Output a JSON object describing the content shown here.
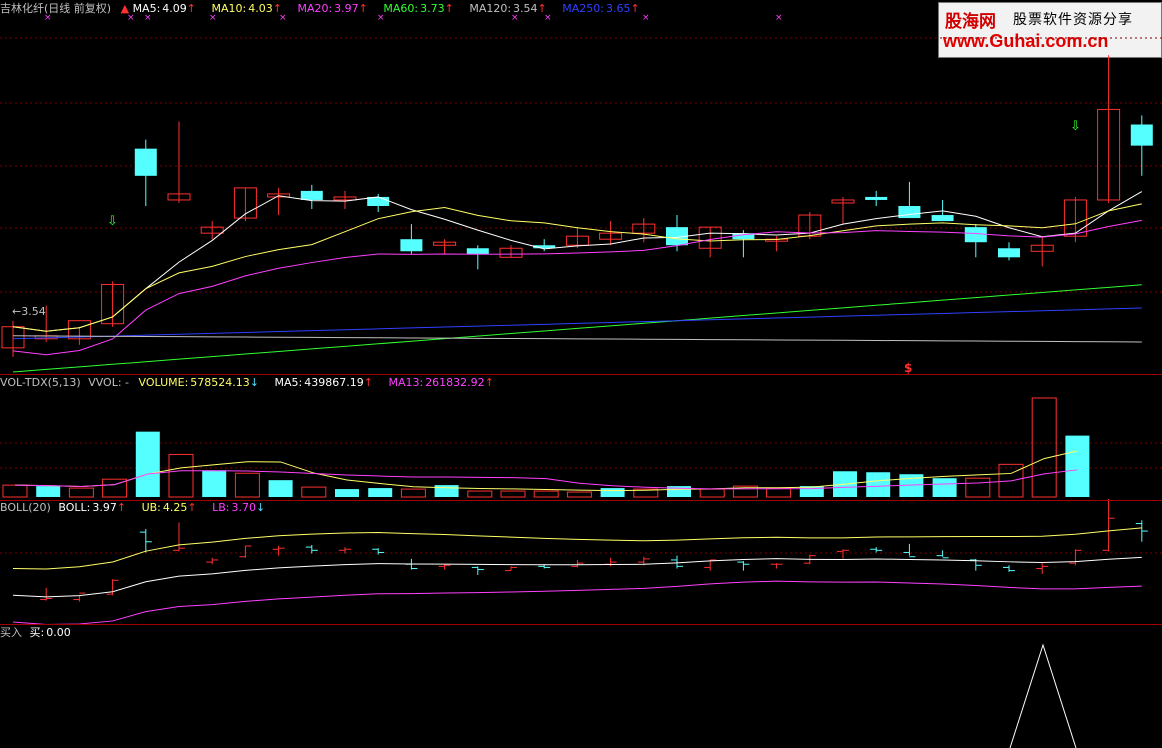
{
  "main": {
    "title": "吉林化纤(日线 前复权)",
    "ma5": {
      "label": "MA5:",
      "value": "4.09",
      "arrow": "↑",
      "color": "#ffffff"
    },
    "ma10": {
      "label": "MA10:",
      "value": "4.03",
      "arrow": "↑",
      "color": "#ffff66"
    },
    "ma20": {
      "label": "MA20:",
      "value": "3.97",
      "arrow": "↑",
      "color": "#ff40ff"
    },
    "ma60": {
      "label": "MA60:",
      "value": "3.73",
      "arrow": "↑",
      "color": "#30ff30"
    },
    "ma120": {
      "label": "MA120:",
      "value": "3.54",
      "arrow": "↑",
      "color": "#c0c0c0"
    },
    "ma250": {
      "label": "MA250:",
      "value": "3.65",
      "arrow": "↑",
      "color": "#3040ff"
    },
    "low_price_label": "←3.54",
    "signal_symbol": "$"
  },
  "volume": {
    "indicator": "VOL-TDX(5,13)",
    "vvol": "VVOL: -",
    "volume": {
      "label": "VOLUME:",
      "value": "578524.13",
      "arrow": "↓"
    },
    "ma5": {
      "label": "MA5:",
      "value": "439867.19",
      "arrow": "↑"
    },
    "ma13": {
      "label": "MA13:",
      "value": "261832.92",
      "arrow": "↑"
    }
  },
  "boll": {
    "indicator": "BOLL(20)",
    "boll": {
      "label": "BOLL:",
      "value": "3.97",
      "arrow": "↑"
    },
    "ub": {
      "label": "UB:",
      "value": "4.25",
      "arrow": "↑"
    },
    "lb": {
      "label": "LB:",
      "value": "3.70",
      "arrow": "↓"
    }
  },
  "signal": {
    "indicator": "买入",
    "buy": {
      "label": "买:",
      "value": "0.00"
    }
  },
  "watermark": {
    "brand": "股海网",
    "tagline": "股票软件资源分享",
    "url": "www.Guhai.com.cn"
  },
  "colors": {
    "up": "#ff3030",
    "down": "#55ffff",
    "ma5": "#ffffff",
    "ma10": "#ffff66",
    "ma20": "#ff40ff",
    "ma60": "#30ff30",
    "ma120": "#c0c0c0",
    "ma250": "#3040ff"
  },
  "chart_data": {
    "type": "candlestick",
    "candles": [
      {
        "o": 3.53,
        "h": 3.62,
        "l": 3.5,
        "c": 3.6
      },
      {
        "o": 3.56,
        "h": 3.67,
        "l": 3.55,
        "c": 3.57
      },
      {
        "o": 3.56,
        "h": 3.6,
        "l": 3.54,
        "c": 3.62
      },
      {
        "o": 3.61,
        "h": 3.75,
        "l": 3.6,
        "c": 3.74
      },
      {
        "o": 4.19,
        "h": 4.22,
        "l": 4.0,
        "c": 4.1
      },
      {
        "o": 4.02,
        "h": 4.28,
        "l": 4.01,
        "c": 4.04
      },
      {
        "o": 3.91,
        "h": 3.95,
        "l": 3.89,
        "c": 3.93
      },
      {
        "o": 3.96,
        "h": 4.06,
        "l": 3.95,
        "c": 4.06
      },
      {
        "o": 4.03,
        "h": 4.06,
        "l": 3.97,
        "c": 4.04
      },
      {
        "o": 4.05,
        "h": 4.07,
        "l": 3.99,
        "c": 4.02
      },
      {
        "o": 4.02,
        "h": 4.05,
        "l": 3.99,
        "c": 4.03
      },
      {
        "o": 4.03,
        "h": 4.04,
        "l": 3.98,
        "c": 4.0
      },
      {
        "o": 3.89,
        "h": 3.94,
        "l": 3.84,
        "c": 3.85
      },
      {
        "o": 3.87,
        "h": 3.89,
        "l": 3.84,
        "c": 3.88
      },
      {
        "o": 3.86,
        "h": 3.87,
        "l": 3.79,
        "c": 3.84
      },
      {
        "o": 3.83,
        "h": 3.87,
        "l": 3.83,
        "c": 3.86
      },
      {
        "o": 3.87,
        "h": 3.89,
        "l": 3.85,
        "c": 3.86
      },
      {
        "o": 3.87,
        "h": 3.93,
        "l": 3.86,
        "c": 3.9
      },
      {
        "o": 3.89,
        "h": 3.95,
        "l": 3.87,
        "c": 3.91
      },
      {
        "o": 3.91,
        "h": 3.96,
        "l": 3.88,
        "c": 3.94
      },
      {
        "o": 3.93,
        "h": 3.97,
        "l": 3.85,
        "c": 3.87
      },
      {
        "o": 3.86,
        "h": 3.93,
        "l": 3.83,
        "c": 3.93
      },
      {
        "o": 3.91,
        "h": 3.92,
        "l": 3.83,
        "c": 3.89
      },
      {
        "o": 3.89,
        "h": 3.9,
        "l": 3.85,
        "c": 3.89
      },
      {
        "o": 3.9,
        "h": 3.98,
        "l": 3.89,
        "c": 3.97
      },
      {
        "o": 4.01,
        "h": 4.03,
        "l": 3.94,
        "c": 4.02
      },
      {
        "o": 4.03,
        "h": 4.05,
        "l": 4.0,
        "c": 4.02
      },
      {
        "o": 4.0,
        "h": 4.08,
        "l": 3.97,
        "c": 3.96
      },
      {
        "o": 3.97,
        "h": 4.02,
        "l": 3.96,
        "c": 3.95
      },
      {
        "o": 3.93,
        "h": 3.94,
        "l": 3.83,
        "c": 3.88
      },
      {
        "o": 3.86,
        "h": 3.88,
        "l": 3.82,
        "c": 3.83
      },
      {
        "o": 3.85,
        "h": 3.9,
        "l": 3.8,
        "c": 3.87
      },
      {
        "o": 3.9,
        "h": 4.03,
        "l": 3.88,
        "c": 4.02
      },
      {
        "o": 4.02,
        "h": 4.5,
        "l": 4.01,
        "c": 4.32
      },
      {
        "o": 4.27,
        "h": 4.3,
        "l": 4.1,
        "c": 4.2
      }
    ],
    "volume": [
      {
        "v": 0.12,
        "up": true
      },
      {
        "v": 0.11,
        "up": false
      },
      {
        "v": 0.09,
        "up": true
      },
      {
        "v": 0.18,
        "up": true
      },
      {
        "v": 0.66,
        "up": false
      },
      {
        "v": 0.43,
        "up": true
      },
      {
        "v": 0.27,
        "up": false
      },
      {
        "v": 0.24,
        "up": true
      },
      {
        "v": 0.17,
        "up": false
      },
      {
        "v": 0.1,
        "up": true
      },
      {
        "v": 0.08,
        "up": false
      },
      {
        "v": 0.09,
        "up": false
      },
      {
        "v": 0.08,
        "up": true
      },
      {
        "v": 0.12,
        "up": false
      },
      {
        "v": 0.06,
        "up": true
      },
      {
        "v": 0.06,
        "up": true
      },
      {
        "v": 0.06,
        "up": true
      },
      {
        "v": 0.05,
        "up": true
      },
      {
        "v": 0.09,
        "up": false
      },
      {
        "v": 0.08,
        "up": true
      },
      {
        "v": 0.11,
        "up": false
      },
      {
        "v": 0.08,
        "up": true
      },
      {
        "v": 0.11,
        "up": true
      },
      {
        "v": 0.09,
        "up": true
      },
      {
        "v": 0.11,
        "up": false
      },
      {
        "v": 0.26,
        "up": false
      },
      {
        "v": 0.25,
        "up": false
      },
      {
        "v": 0.23,
        "up": false
      },
      {
        "v": 0.19,
        "up": false
      },
      {
        "v": 0.19,
        "up": true
      },
      {
        "v": 0.33,
        "up": true
      },
      {
        "v": 1.0,
        "up": true
      },
      {
        "v": 0.62,
        "up": false
      }
    ]
  }
}
